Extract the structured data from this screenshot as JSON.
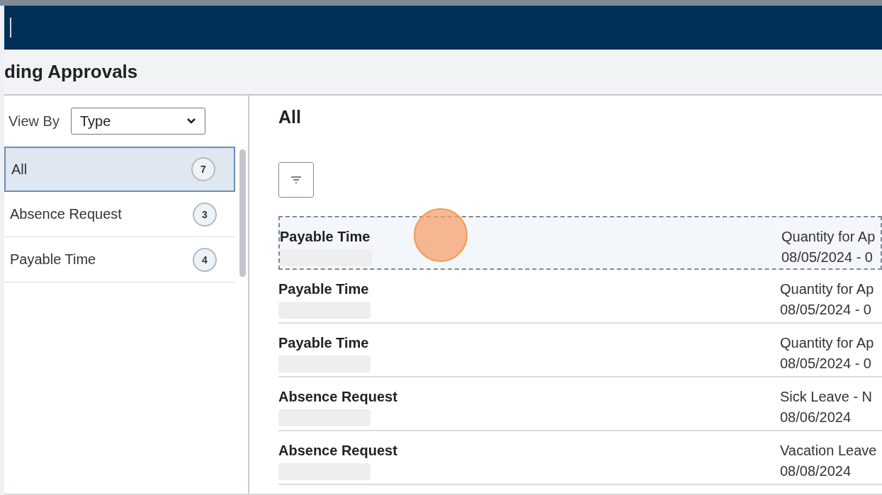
{
  "page_title": "ding Approvals",
  "view_by": {
    "label": "View By",
    "value": "Type"
  },
  "categories": [
    {
      "label": "All",
      "count": "7",
      "selected": true
    },
    {
      "label": "Absence Request",
      "count": "3",
      "selected": false
    },
    {
      "label": "Payable Time",
      "count": "4",
      "selected": false
    }
  ],
  "content": {
    "heading": "All",
    "items": [
      {
        "title": "Payable Time",
        "detail": "Quantity for Ap",
        "date": "08/05/2024 - 0",
        "selected": true
      },
      {
        "title": "Payable Time",
        "detail": "Quantity for Ap",
        "date": "08/05/2024 - 0",
        "selected": false
      },
      {
        "title": "Payable Time",
        "detail": "Quantity for Ap",
        "date": "08/05/2024 - 0",
        "selected": false
      },
      {
        "title": "Absence Request",
        "detail": "Sick Leave - N",
        "date": "08/06/2024",
        "selected": false
      },
      {
        "title": "Absence Request",
        "detail": "Vacation Leave",
        "date": "08/08/2024",
        "selected": false
      }
    ]
  }
}
